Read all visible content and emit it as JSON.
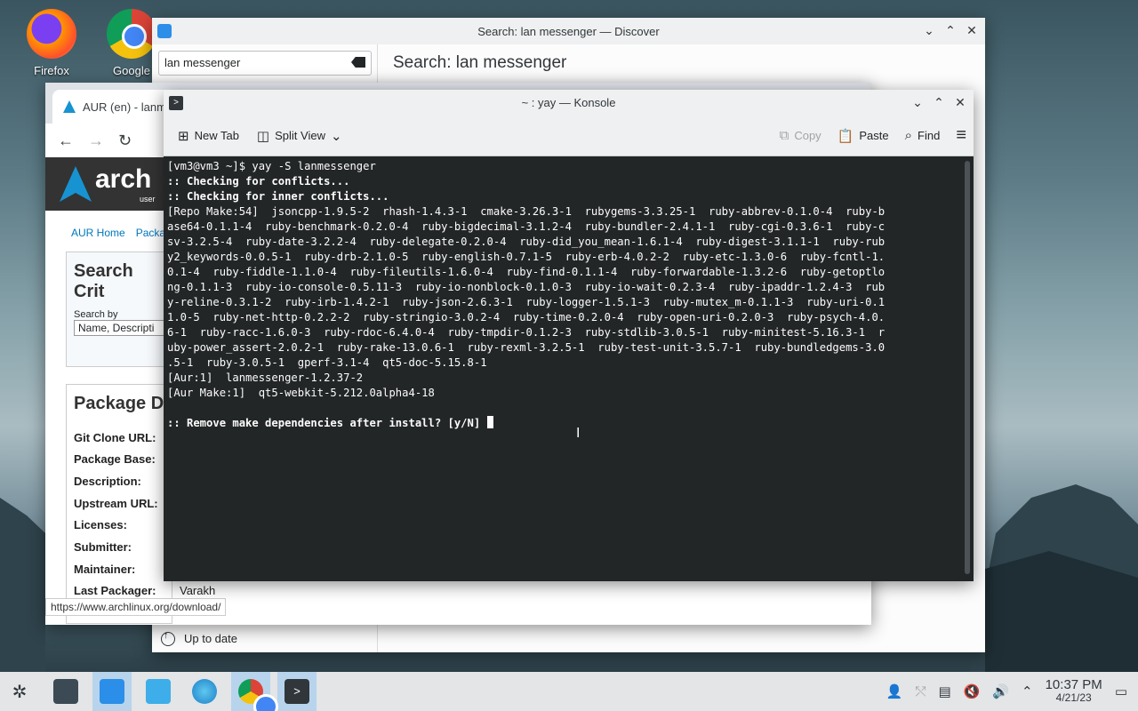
{
  "desktop": {
    "icons": [
      {
        "label": "Firefox"
      },
      {
        "label": "Google"
      }
    ]
  },
  "discover": {
    "title": "Search: lan messenger — Discover",
    "search_value": "lan messenger",
    "heading": "Search: lan messenger",
    "status": "Up to date"
  },
  "chrome": {
    "tab_title": "AUR (en) - lanm",
    "nav": [
      "AUR Home",
      "Packa"
    ],
    "logo_text": "arch",
    "logo_sub": "user",
    "search_heading": "Search Crit",
    "search_by_label": "Search by",
    "search_by_value": "Name, Descripti",
    "details_heading": "Package D",
    "details": [
      {
        "label": "Git Clone URL:",
        "value": ""
      },
      {
        "label": "Package Base:",
        "value": ""
      },
      {
        "label": "Description:",
        "value": ""
      },
      {
        "label": "Upstream URL:",
        "value": ""
      },
      {
        "label": "Licenses:",
        "value": ""
      },
      {
        "label": "Submitter:",
        "value": ""
      },
      {
        "label": "Maintainer:",
        "value": ""
      },
      {
        "label": "Last Packager:",
        "value": "Varakh"
      }
    ],
    "status_url": "https://www.archlinux.org/download/"
  },
  "konsole": {
    "title": "~ : yay — Konsole",
    "toolbar": {
      "new_tab": "New Tab",
      "split_view": "Split View",
      "copy": "Copy",
      "paste": "Paste",
      "find": "Find"
    },
    "lines": [
      {
        "text": "[vm3@vm3 ~]$ yay -S lanmessenger",
        "bold": false
      },
      {
        "text": ":: Checking for conflicts...",
        "bold": true
      },
      {
        "text": ":: Checking for inner conflicts...",
        "bold": true
      },
      {
        "text": "[Repo Make:54]  jsoncpp-1.9.5-2  rhash-1.4.3-1  cmake-3.26.3-1  rubygems-3.3.25-1  ruby-abbrev-0.1.0-4  ruby-b",
        "bold": false
      },
      {
        "text": "ase64-0.1.1-4  ruby-benchmark-0.2.0-4  ruby-bigdecimal-3.1.2-4  ruby-bundler-2.4.1-1  ruby-cgi-0.3.6-1  ruby-c",
        "bold": false
      },
      {
        "text": "sv-3.2.5-4  ruby-date-3.2.2-4  ruby-delegate-0.2.0-4  ruby-did_you_mean-1.6.1-4  ruby-digest-3.1.1-1  ruby-rub",
        "bold": false
      },
      {
        "text": "y2_keywords-0.0.5-1  ruby-drb-2.1.0-5  ruby-english-0.7.1-5  ruby-erb-4.0.2-2  ruby-etc-1.3.0-6  ruby-fcntl-1.",
        "bold": false
      },
      {
        "text": "0.1-4  ruby-fiddle-1.1.0-4  ruby-fileutils-1.6.0-4  ruby-find-0.1.1-4  ruby-forwardable-1.3.2-6  ruby-getoptlo",
        "bold": false
      },
      {
        "text": "ng-0.1.1-3  ruby-io-console-0.5.11-3  ruby-io-nonblock-0.1.0-3  ruby-io-wait-0.2.3-4  ruby-ipaddr-1.2.4-3  rub",
        "bold": false
      },
      {
        "text": "y-reline-0.3.1-2  ruby-irb-1.4.2-1  ruby-json-2.6.3-1  ruby-logger-1.5.1-3  ruby-mutex_m-0.1.1-3  ruby-uri-0.1",
        "bold": false
      },
      {
        "text": "1.0-5  ruby-net-http-0.2.2-2  ruby-stringio-3.0.2-4  ruby-time-0.2.0-4  ruby-open-uri-0.2.0-3  ruby-psych-4.0.",
        "bold": false
      },
      {
        "text": "6-1  ruby-racc-1.6.0-3  ruby-rdoc-6.4.0-4  ruby-tmpdir-0.1.2-3  ruby-stdlib-3.0.5-1  ruby-minitest-5.16.3-1  r",
        "bold": false
      },
      {
        "text": "uby-power_assert-2.0.2-1  ruby-rake-13.0.6-1  ruby-rexml-3.2.5-1  ruby-test-unit-3.5.7-1  ruby-bundledgems-3.0",
        "bold": false
      },
      {
        "text": ".5-1  ruby-3.0.5-1  gperf-3.1-4  qt5-doc-5.15.8-1",
        "bold": false
      },
      {
        "text": "[Aur:1]  lanmessenger-1.2.37-2",
        "bold": false
      },
      {
        "text": "[Aur Make:1]  qt5-webkit-5.212.0alpha4-18",
        "bold": false
      },
      {
        "text": "",
        "bold": false
      },
      {
        "text": ":: Remove make dependencies after install? [y/N] ",
        "bold": true
      }
    ]
  },
  "taskbar": {
    "time": "10:37 PM",
    "date": "4/21/23"
  }
}
